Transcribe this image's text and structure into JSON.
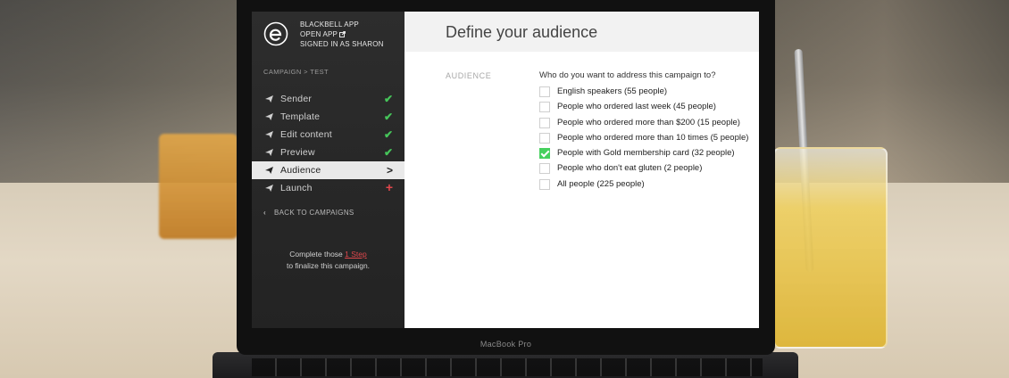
{
  "device": {
    "label": "MacBook Pro"
  },
  "app": {
    "lines": [
      "BLACKBELL APP",
      "OPEN APP",
      "SIGNED IN AS SHARON"
    ],
    "open_icon": "external-link-icon"
  },
  "breadcrumb": "CAMPAIGN > TEST",
  "steps": [
    {
      "label": "Sender",
      "status": "✔",
      "state": "done"
    },
    {
      "label": "Template",
      "status": "✔",
      "state": "done"
    },
    {
      "label": "Edit content",
      "status": "✔",
      "state": "done"
    },
    {
      "label": "Preview",
      "status": "✔",
      "state": "done"
    },
    {
      "label": "Audience",
      "status": ">",
      "state": "active"
    },
    {
      "label": "Launch",
      "status": "+",
      "state": "todo"
    }
  ],
  "back_label": "BACK TO CAMPAIGNS",
  "finalize": {
    "prefix": "Complete those ",
    "link": "1 Step",
    "suffix": "to finalize this campaign."
  },
  "page_title": "Define your audience",
  "section_label": "AUDIENCE",
  "question": "Who do you want to address this campaign to?",
  "options": [
    {
      "label": "English speakers (55 people)",
      "checked": false
    },
    {
      "label": "People who ordered last week (45 people)",
      "checked": false
    },
    {
      "label": "People who ordered more than $200 (15 people)",
      "checked": false
    },
    {
      "label": "People who ordered more than 10 times (5 people)",
      "checked": false
    },
    {
      "label": "People with Gold membership card (32 people)",
      "checked": true
    },
    {
      "label": "People who don't eat gluten (2 people)",
      "checked": false
    },
    {
      "label": "All people (225 people)",
      "checked": false
    }
  ],
  "colors": {
    "accent_green": "#46c55a",
    "accent_red": "#e0474c",
    "sidebar_bg": "#2d2d2d"
  }
}
